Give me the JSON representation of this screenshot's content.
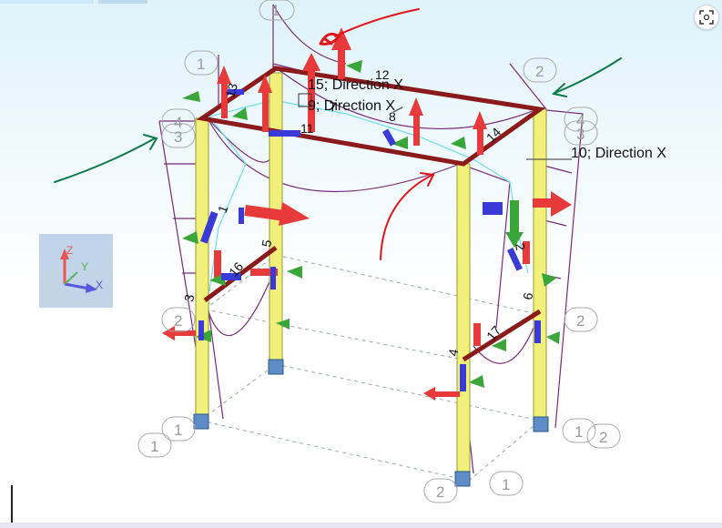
{
  "viewport": {
    "name": "3D structural model view"
  },
  "annotations": [
    {
      "id": "ann-15",
      "text": "15; Direction X"
    },
    {
      "id": "ann-9",
      "text": "9; Direction X"
    },
    {
      "id": "ann-10",
      "text": "10; Direction X"
    }
  ],
  "members": [
    {
      "id": "m1",
      "text": "1"
    },
    {
      "id": "m2",
      "text": "2"
    },
    {
      "id": "m3",
      "text": "3"
    },
    {
      "id": "m4",
      "text": "4"
    },
    {
      "id": "m5",
      "text": "5"
    },
    {
      "id": "m6",
      "text": "6"
    },
    {
      "id": "m7",
      "text": "7"
    },
    {
      "id": "m8",
      "text": "8"
    },
    {
      "id": "m11",
      "text": "11"
    },
    {
      "id": "m12",
      "text": "12"
    },
    {
      "id": "m13",
      "text": "13"
    },
    {
      "id": "m14",
      "text": "14"
    },
    {
      "id": "m16",
      "text": "16"
    },
    {
      "id": "m17",
      "text": "17"
    }
  ],
  "grid_labels": {
    "a": "1",
    "b": "1",
    "c": "2",
    "d": "4",
    "e": "3",
    "f": "4",
    "g": "3",
    "h": "2",
    "i": "2",
    "j": "1",
    "k": "1",
    "l": "1",
    "m": "2",
    "n": "2",
    "o": "1"
  },
  "triad": {
    "z": "Z",
    "y": "Y",
    "x": "X"
  },
  "screenshot_icon": "screenshot-capture-icon",
  "colors": {
    "column": "#f0f07a",
    "beam": "#8b1a1a",
    "diagram": "#7a2a7a",
    "support": "#4a7ab7",
    "arrow_red": "#e83a3a",
    "arrow_green": "#3aa63a",
    "arrow_blue": "#3a3ad8",
    "ink_red": "#e0161a",
    "ink_green": "#0f7a4a"
  }
}
